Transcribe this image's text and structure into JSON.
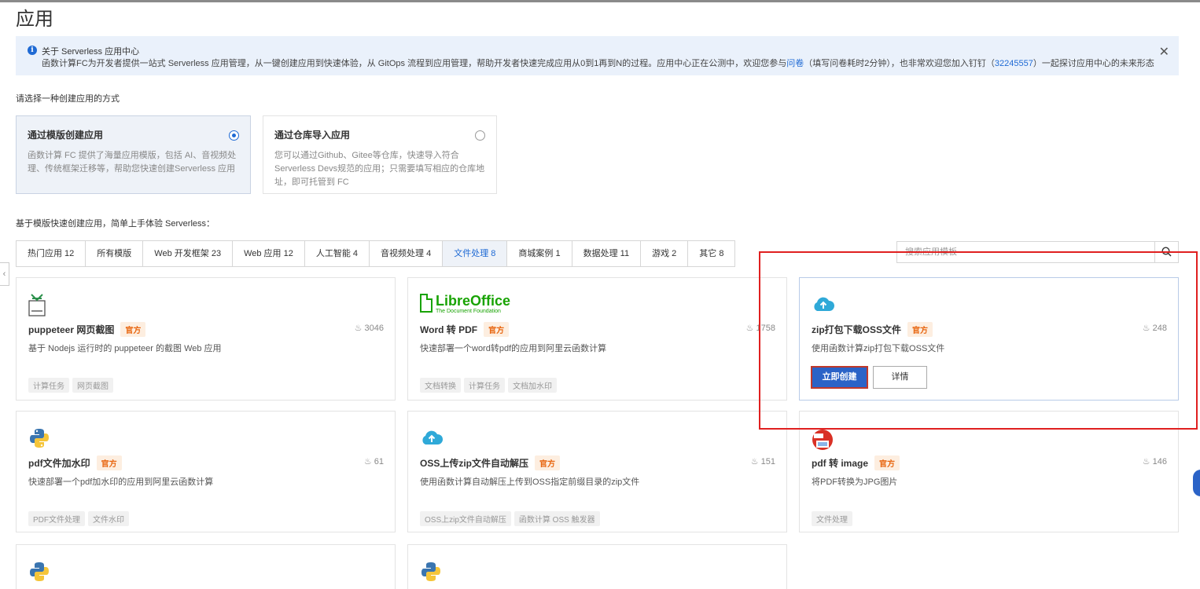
{
  "page": {
    "title": "应用"
  },
  "notice": {
    "title": "关于 Serverless 应用中心",
    "body_1": "函数计算FC为开发者提供一站式 Serverless 应用管理，从一键创建应用到快速体验，从 GitOps 流程到应用管理，帮助开发者快速完成应用从0到1再到N的过程。应用中心正在公测中，欢迎您参与",
    "link_1": "问卷",
    "body_2": "（填写问卷耗时2分钟），也非常欢迎您加入钉钉（",
    "link_2": "32245557",
    "body_3": "）一起探讨应用中心的未来形态"
  },
  "create_method": {
    "label": "请选择一种创建应用的方式",
    "options": [
      {
        "title": "通过模版创建应用",
        "desc": "函数计算 FC 提供了海量应用模版，包括 AI、音视频处理、传统框架迁移等，帮助您快速创建Serverless 应用",
        "selected": true
      },
      {
        "title": "通过仓库导入应用",
        "desc": "您可以通过Github、Gitee等仓库，快速导入符合 Serverless Devs规范的应用；只需要填写相应的仓库地址，即可托管到 FC",
        "selected": false
      }
    ]
  },
  "templates": {
    "label": "基于模版快速创建应用，简单上手体验 Serverless：",
    "tabs": [
      {
        "label": "热门应用 12"
      },
      {
        "label": "所有模版"
      },
      {
        "label": "Web 开发框架 23"
      },
      {
        "label": "Web 应用 12"
      },
      {
        "label": "人工智能 4"
      },
      {
        "label": "音视频处理 4"
      },
      {
        "label": "文件处理 8",
        "active": true
      },
      {
        "label": "商城案例 1"
      },
      {
        "label": "数据处理 11"
      },
      {
        "label": "游戏 2"
      },
      {
        "label": "其它 8"
      }
    ],
    "search": {
      "placeholder": "搜索应用模板"
    }
  },
  "libreoffice_logo": {
    "name": "LibreOffice",
    "sub": "The Document Foundation"
  },
  "cards": [
    {
      "title": "puppeteer 网页截图",
      "badge": "官方",
      "likes": "3046",
      "desc": "基于 Nodejs 运行时的 puppeteer 的截图 Web 应用",
      "tags": [
        "计算任务",
        "网页截图"
      ],
      "icon": "puppeteer-icon"
    },
    {
      "title": "Word 转 PDF",
      "badge": "官方",
      "likes": "1758",
      "desc": "快速部署一个word转pdf的应用到阿里云函数计算",
      "tags": [
        "文档转换",
        "计算任务",
        "文档加水印"
      ],
      "icon": "libreoffice-icon"
    },
    {
      "title": "zip打包下载OSS文件",
      "badge": "官方",
      "likes": "248",
      "desc": "使用函数计算zip打包下载OSS文件",
      "tags": [],
      "icon": "cloud-icon",
      "create_label": "立即创建",
      "detail_label": "详情"
    },
    {
      "title": "pdf文件加水印",
      "badge": "官方",
      "likes": "61",
      "desc": "快速部署一个pdf加水印的应用到阿里云函数计算",
      "tags": [
        "PDF文件处理",
        "文件水印"
      ],
      "icon": "python-icon"
    },
    {
      "title": "OSS上传zip文件自动解压",
      "badge": "官方",
      "likes": "151",
      "desc": "使用函数计算自动解压上传到OSS指定前缀目录的zip文件",
      "tags": [
        "OSS上zip文件自动解压",
        "函数计算 OSS 触发器"
      ],
      "icon": "cloud-icon"
    },
    {
      "title": "pdf 转 image",
      "badge": "官方",
      "likes": "146",
      "desc": "将PDF转换为JPG图片",
      "tags": [
        "文件处理"
      ],
      "icon": "pdf-icon"
    }
  ],
  "colors": {
    "accent": "#1f6ad4",
    "primary_button": "#2b63c7",
    "badge_text": "#e8650f",
    "badge_bg": "#fdeee0",
    "annotation_red": "#e02020"
  }
}
